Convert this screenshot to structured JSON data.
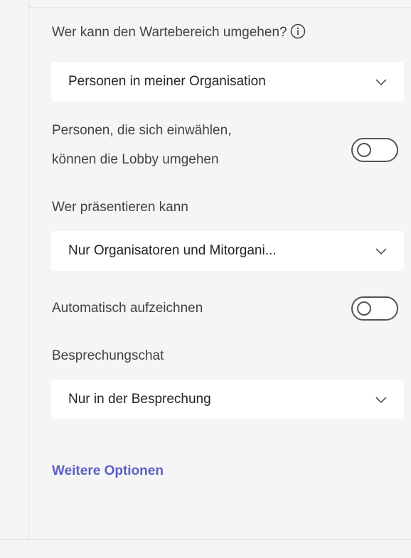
{
  "lobby_bypass": {
    "label": "Wer kann den Wartebereich umgehen?",
    "selected": "Personen in meiner Organisation"
  },
  "dial_in_bypass": {
    "label_line1": "Personen, die sich einwählen,",
    "label_line2": "können die Lobby umgehen",
    "enabled": false
  },
  "presenters": {
    "label": "Wer präsentieren kann",
    "selected": "Nur Organisatoren und Mitorgani..."
  },
  "auto_record": {
    "label": "Automatisch aufzeichnen",
    "enabled": false
  },
  "meeting_chat": {
    "label": "Besprechungschat",
    "selected": "Nur in der Besprechung"
  },
  "more_options_link": "Weitere Optionen",
  "colors": {
    "link": "#5b5fc7",
    "background": "#f5f5f5",
    "dropdown_bg": "#ffffff",
    "text": "#424242"
  }
}
